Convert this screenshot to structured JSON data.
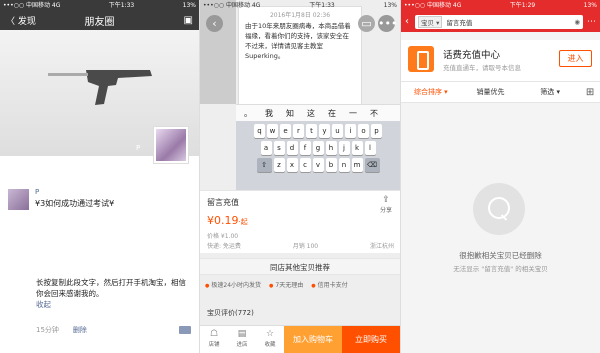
{
  "moments": {
    "status": {
      "carrier": "•••○○ 中国移动 4G",
      "time": "下午1:33",
      "battery": "13%"
    },
    "nav": {
      "back": "〈 发现",
      "title": "朋友圈"
    },
    "cover_name": "P",
    "post1": {
      "name": "P",
      "text": "¥3如何成功通过考试¥"
    },
    "post2": {
      "text": "长按复制此段文字，然后打开手机淘宝，相信你会回来感谢我的。",
      "fold": "收起"
    },
    "meta": {
      "time": "15分钟",
      "delete": "删除"
    }
  },
  "taobao_item": {
    "status": {
      "carrier": "•••○○ 中国移动 4G",
      "time": "下午1:33",
      "battery": "13%"
    },
    "note": {
      "date": "2016年1月8日 02:36",
      "text": "由于10年来朋友圈病毒，本商品借着福缘，看着你们的支持，该家安全在不过来，详情请见客主教室 Superking。"
    },
    "candidates": [
      "。",
      "我",
      "知",
      "这",
      "在",
      "一",
      "不"
    ],
    "keys": {
      "row1": [
        "q",
        "w",
        "e",
        "r",
        "t",
        "y",
        "u",
        "i",
        "o",
        "p"
      ],
      "row2": [
        "a",
        "s",
        "d",
        "f",
        "g",
        "h",
        "j",
        "k",
        "l"
      ],
      "row3": [
        "z",
        "x",
        "c",
        "v",
        "b",
        "n",
        "m"
      ]
    },
    "product": {
      "title": "留言充值",
      "share": "分享",
      "price": "¥0.19",
      "price_unit": "·起",
      "orig": "价格 ¥1.00",
      "row": [
        "快递: 免运费",
        "月销 100",
        "浙江杭州"
      ]
    },
    "band": "同店其他宝贝推荐",
    "tags": [
      "极速24小时内发货",
      "7天无理由",
      "信用卡支付"
    ],
    "eval": "宝贝评价(772)",
    "bottom": {
      "shop": "店铺",
      "store": "进店",
      "fav": "收藏",
      "cart": "加入购物车",
      "buy": "立即购买"
    }
  },
  "search": {
    "status": {
      "carrier": "•••○○ 中国移动 4G",
      "time": "下午1:29",
      "battery": "13%"
    },
    "search_tag": "宝贝 ▾",
    "query": "留言充值",
    "shop": {
      "name": "话费充值中心",
      "sub": "充值直通车，请取号本信息",
      "enter": "进入"
    },
    "sort": [
      "综合排序 ▾",
      "销量优先",
      "筛选 ▾"
    ],
    "empty1": "很抱歉相关宝贝已经删除",
    "empty2": "无法显示 \"留言充值\" 的相关宝贝"
  }
}
